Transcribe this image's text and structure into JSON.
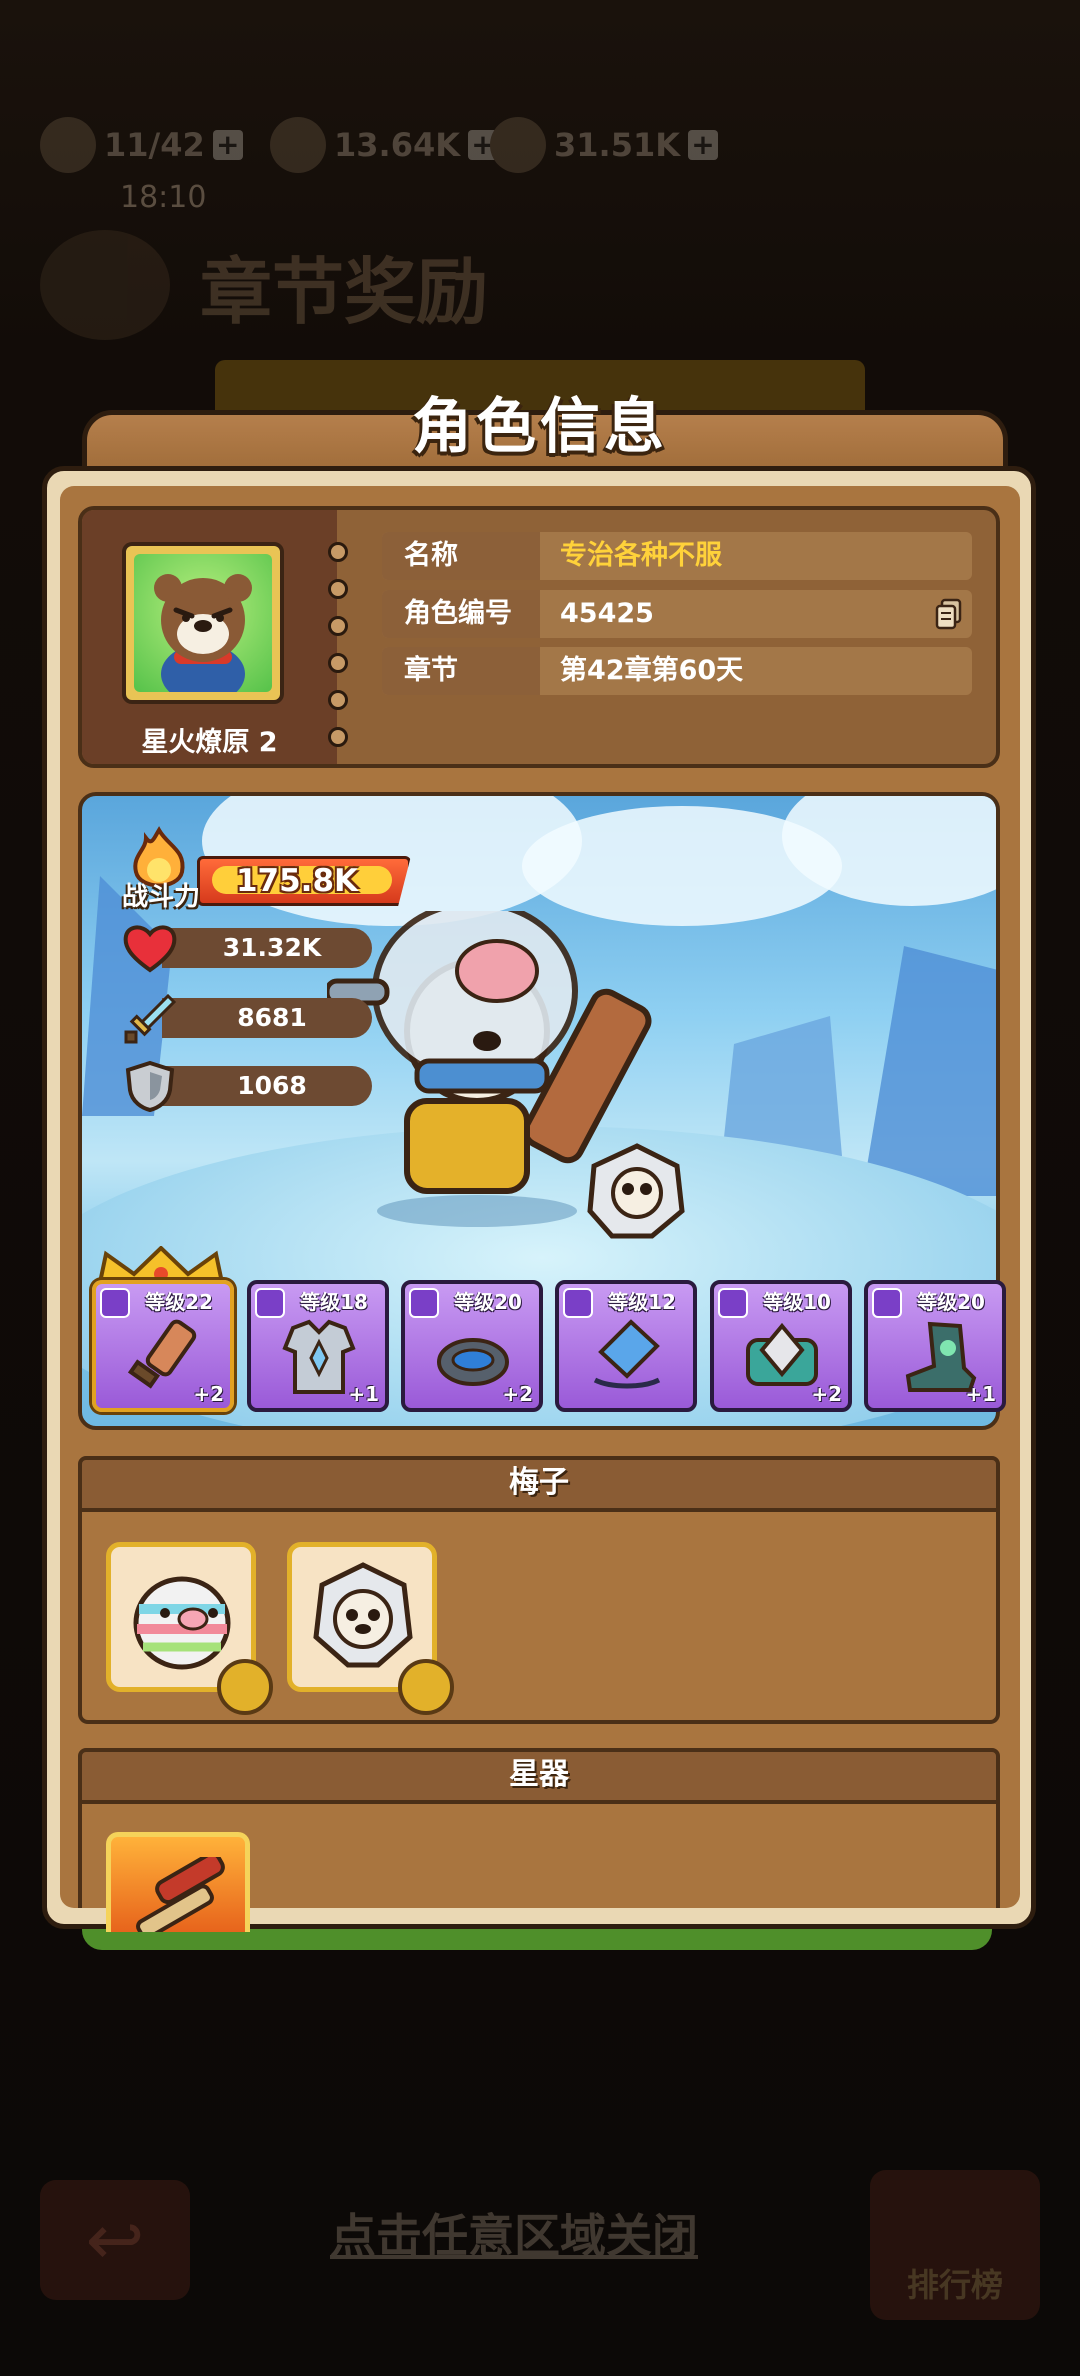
{
  "background": {
    "stats": [
      {
        "value": "11/42",
        "icon": "lightning-icon"
      },
      {
        "value": "13.64K",
        "icon": "gem-icon"
      },
      {
        "value": "31.51K",
        "icon": "coin-icon"
      }
    ],
    "timer": "18:10",
    "page_title": "章节奖励",
    "close_hint": "点击任意区域关闭",
    "rank_button": "排行榜"
  },
  "modal": {
    "title": "角色信息",
    "profile": {
      "player_name": "星火燎原 2",
      "rows": [
        {
          "label": "名称",
          "value": "专治各种不服",
          "highlight": true
        },
        {
          "label": "角色编号",
          "value": "45425",
          "copyable": true
        },
        {
          "label": "章节",
          "value": "第42章第60天"
        }
      ]
    },
    "battle": {
      "power_label": "战斗力",
      "power_value": "175.8K",
      "stats": [
        {
          "icon": "heart-icon",
          "value": "31.32K"
        },
        {
          "icon": "sword-icon",
          "value": "8681"
        },
        {
          "icon": "shield-icon",
          "value": "1068"
        }
      ],
      "equipment": [
        {
          "slot": "weapon",
          "level": "等级22",
          "plus": "+2",
          "icon": "sword-weapon-icon",
          "quality": "gold"
        },
        {
          "slot": "armor",
          "level": "等级18",
          "plus": "+1",
          "icon": "armor-icon",
          "quality": "purple"
        },
        {
          "slot": "ring",
          "level": "等级20",
          "plus": "+2",
          "icon": "ring-icon",
          "quality": "purple"
        },
        {
          "slot": "necklace",
          "level": "等级12",
          "plus": "",
          "icon": "necklace-icon",
          "quality": "purple"
        },
        {
          "slot": "belt",
          "level": "等级10",
          "plus": "+2",
          "icon": "belt-icon",
          "quality": "purple"
        },
        {
          "slot": "boots",
          "level": "等级20",
          "plus": "+1",
          "icon": "boots-icon",
          "quality": "purple"
        }
      ]
    },
    "pets_section": {
      "title": "梅子",
      "pets": [
        {
          "icon": "striped-pig-pet-icon"
        },
        {
          "icon": "gear-bear-pet-icon"
        }
      ]
    },
    "star_section": {
      "title": "星器",
      "items": [
        {
          "icon": "star-weapon-icon"
        }
      ]
    }
  }
}
